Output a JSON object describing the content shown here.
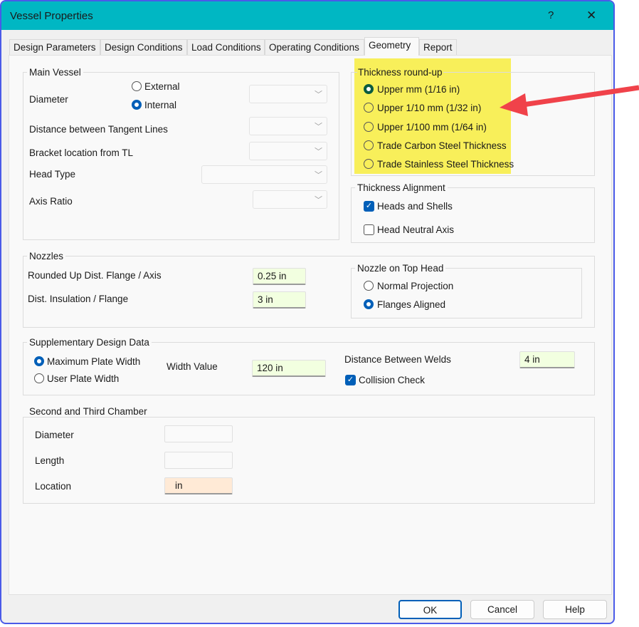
{
  "window": {
    "title": "Vessel Properties",
    "help_label": "?",
    "close_label": "✕"
  },
  "tabs": [
    "Design Parameters",
    "Design Conditions",
    "Load Conditions",
    "Operating Conditions",
    "Geometry",
    "Report"
  ],
  "active_tab": "Geometry",
  "main_vessel": {
    "title": "Main Vessel",
    "diameter_label": "Diameter",
    "external_label": "External",
    "internal_label": "Internal",
    "selected": "Internal",
    "dist_tangent_label": "Distance between Tangent Lines",
    "bracket_label": "Bracket location from TL",
    "head_type_label": "Head Type",
    "axis_ratio_label": "Axis Ratio"
  },
  "thickness_roundup": {
    "title": "Thickness round-up",
    "options": [
      "Upper mm (1/16 in)",
      "Upper 1/10 mm (1/32 in)",
      "Upper 1/100 mm (1/64 in)",
      "Trade Carbon Steel Thickness",
      "Trade Stainless Steel Thickness"
    ],
    "selected": "Upper mm (1/16 in)",
    "highlight_color": "#f8ef5a",
    "arrow_color": "#f0424a"
  },
  "thickness_alignment": {
    "title": "Thickness Alignment",
    "heads_shells_label": "Heads and Shells",
    "heads_shells_checked": true,
    "neutral_axis_label": "Head Neutral Axis",
    "neutral_axis_checked": false
  },
  "nozzles": {
    "title": "Nozzles",
    "rounded_label": "Rounded Up Dist. Flange / Axis",
    "rounded_value": "0.25 in",
    "insulation_label": "Dist. Insulation / Flange",
    "insulation_value": "3 in",
    "top_head": {
      "title": "Nozzle on Top Head",
      "normal_label": "Normal Projection",
      "flanges_label": "Flanges Aligned",
      "selected": "Flanges Aligned"
    }
  },
  "supplementary": {
    "title": "Supplementary Design Data",
    "max_plate_label": "Maximum Plate Width",
    "user_plate_label": "User Plate Width",
    "selected": "Maximum Plate Width",
    "width_value_label": "Width Value",
    "width_value": "120 in",
    "welds_label": "Distance Between Welds",
    "welds_value": "4 in",
    "collision_label": "Collision Check",
    "collision_checked": true
  },
  "chamber": {
    "title": "Second and Third Chamber",
    "diameter_label": "Diameter",
    "length_label": "Length",
    "location_label": "Location",
    "location_value": "in"
  },
  "buttons": {
    "ok": "OK",
    "cancel": "Cancel",
    "help": "Help"
  }
}
